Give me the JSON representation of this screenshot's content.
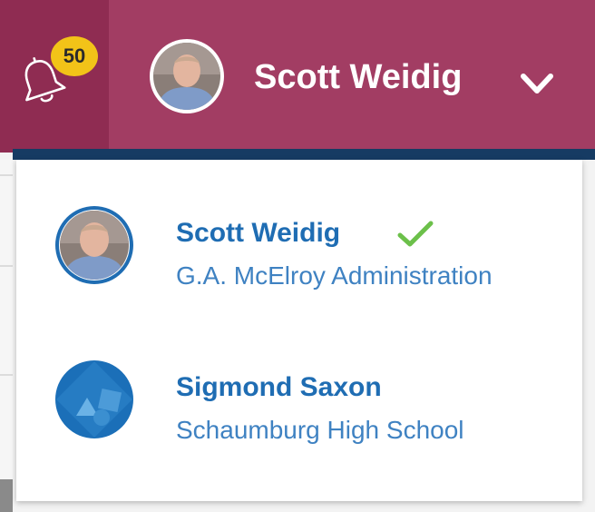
{
  "header": {
    "notifications": {
      "icon": "bell-icon",
      "count": "50"
    },
    "current_user": {
      "name": "Scott Weidig",
      "avatar_icon": "person-photo-avatar",
      "dropdown_icon": "chevron-down-icon"
    }
  },
  "accounts": [
    {
      "name": "Scott Weidig",
      "organization": "G.A. McElroy Administration",
      "avatar_icon": "person-photo-avatar",
      "selected": true,
      "selected_icon": "checkmark-icon"
    },
    {
      "name": "Sigmond Saxon",
      "organization": "Schaumburg High School",
      "avatar_icon": "geometric-shapes-avatar",
      "selected": false
    }
  ],
  "colors": {
    "header_bg": "#a23d63",
    "bell_zone_bg": "#8f2c52",
    "badge_bg": "#f2c318",
    "divider": "#163b63",
    "name_text": "#1f6db3",
    "org_text": "#3f82c2",
    "check": "#6cc04a"
  }
}
